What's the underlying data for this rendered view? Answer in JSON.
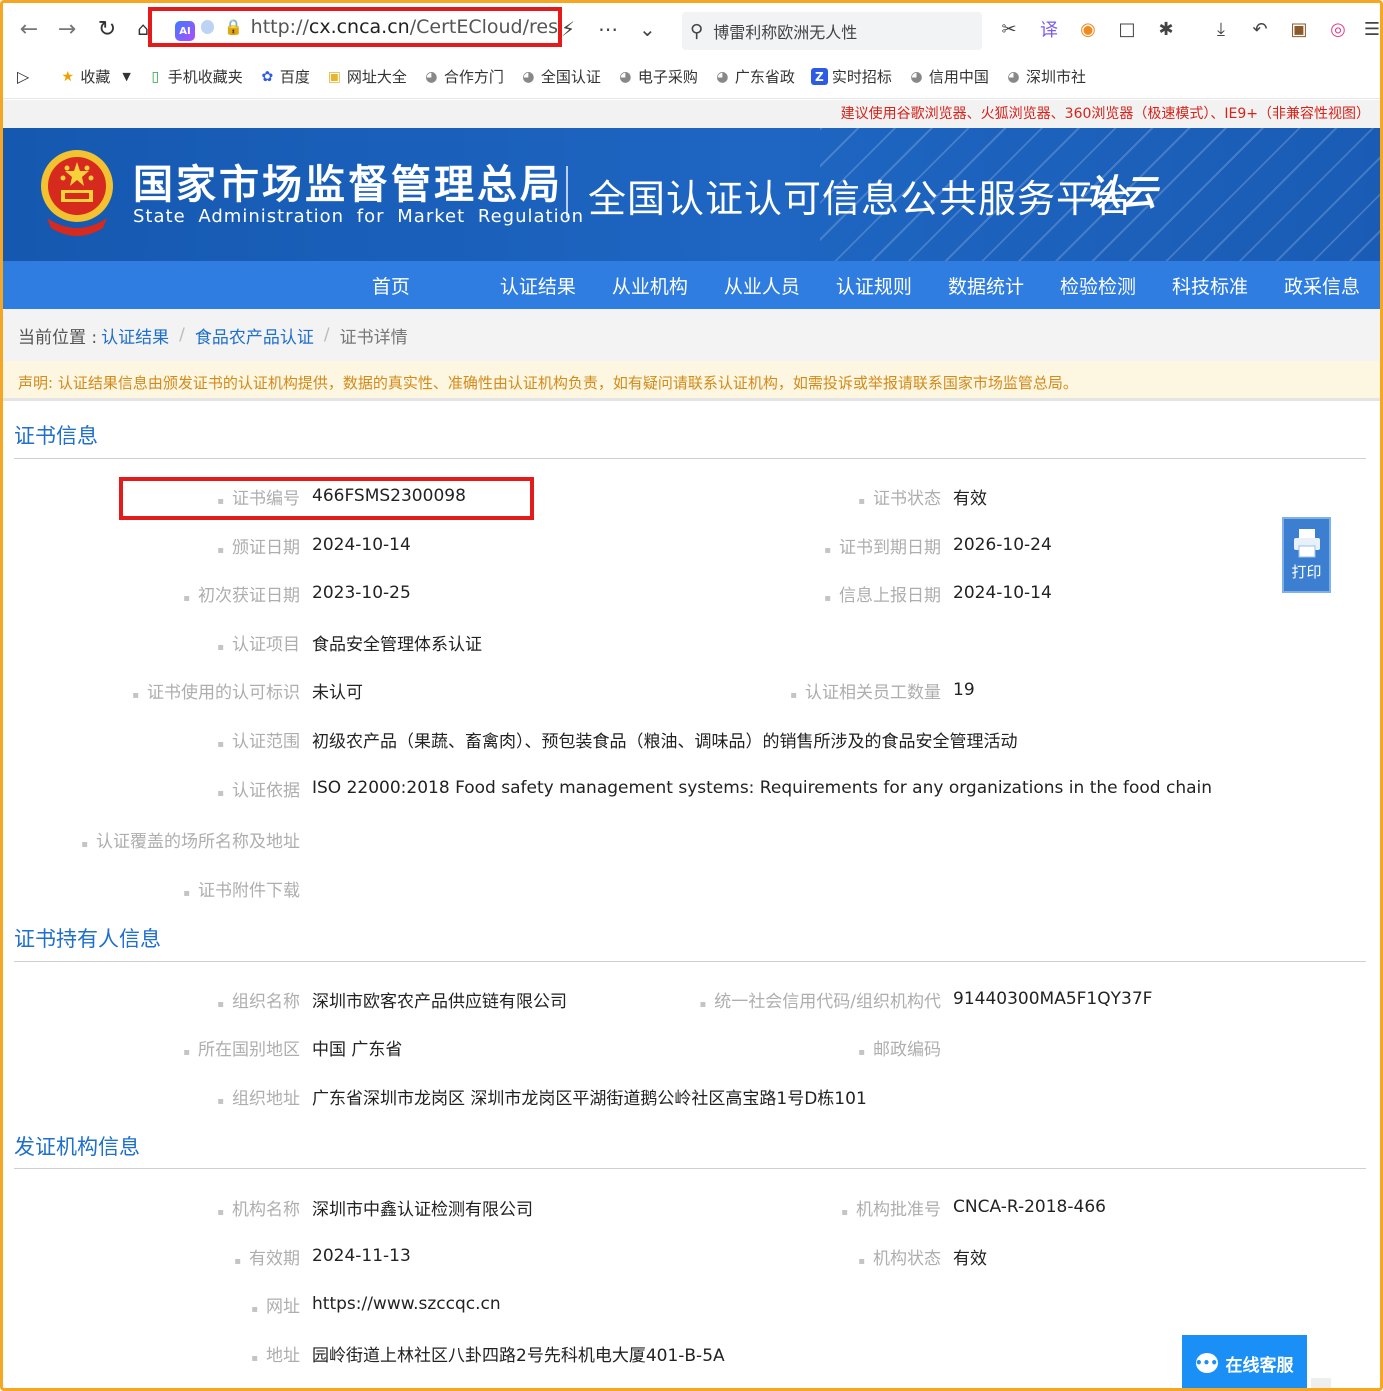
{
  "browser": {
    "url_prefix": "http://",
    "url_domain": "cx.cnca.cn",
    "url_path": "/CertECloud/res",
    "search_text": "博雷利称欧洲无人性",
    "ai_badge": "AI"
  },
  "bookmarks": [
    "收藏",
    "手机收藏夹",
    "百度",
    "网址大全",
    "合作方门",
    "全国认证",
    "电子采购",
    "广东省政",
    "实时招标",
    "信用中国",
    "深圳市社"
  ],
  "advisory": "建议使用谷歌浏览器、火狐浏览器、360浏览器（极速模式）、IE9+（非兼容性视图）",
  "banner": {
    "agency_cn": "国家市场监督管理总局",
    "agency_en": "State Administration  for  Market Regulation",
    "platform": "全国认证认可信息公共服务平台",
    "platform_logo": "认云"
  },
  "nav": [
    "首页",
    "认证结果",
    "从业机构",
    "从业人员",
    "认证规则",
    "数据统计",
    "检验检测",
    "科技标准",
    "政采信息"
  ],
  "breadcrumb": {
    "prefix": "当前位置 :",
    "items": [
      "认证结果",
      "食品农产品认证",
      "证书详情"
    ]
  },
  "disclaimer": "声明: 认证结果信息由颁发证书的认证机构提供，数据的真实性、准确性由认证机构负责，如有疑问请联系认证机构，如需投诉或举报请联系国家市场监管总局。",
  "cert_info": {
    "title": "证书信息",
    "cert_no_label": "证书编号",
    "cert_no": "466FSMS2300098",
    "status_label": "证书状态",
    "status": "有效",
    "issue_date_label": "颁证日期",
    "issue_date": "2024-10-14",
    "expiry_label": "证书到期日期",
    "expiry": "2026-10-24",
    "first_date_label": "初次获证日期",
    "first_date": "2023-10-25",
    "report_date_label": "信息上报日期",
    "report_date": "2024-10-14",
    "project_label": "认证项目",
    "project": "食品安全管理体系认证",
    "accred_label": "证书使用的认可标识",
    "accred": "未认可",
    "staff_label": "认证相关员工数量",
    "staff": "19",
    "scope_label": "认证范围",
    "scope": "初级农产品（果蔬、畜禽肉）、预包装食品（粮油、调味品）的销售所涉及的食品安全管理活动",
    "basis_label": "认证依据",
    "basis": "ISO 22000:2018 Food safety management systems: Requirements for any organizations in the food chain",
    "sites_label": "认证覆盖的场所名称及地址",
    "attach_label": "证书附件下载"
  },
  "print_label": "打印",
  "holder_info": {
    "title": "证书持有人信息",
    "org_label": "组织名称",
    "org": "深圳市欧客农产品供应链有限公司",
    "credit_label": "统一社会信用代码/组织机构代",
    "credit": "91440300MA5F1QY37F",
    "region_label": "所在国别地区",
    "region": "中国 广东省",
    "postcode_label": "邮政编码",
    "addr_label": "组织地址",
    "addr": "广东省深圳市龙岗区 深圳市龙岗区平湖街道鹅公岭社区高宝路1号D栋101"
  },
  "issuer_info": {
    "title": "发证机构信息",
    "name_label": "机构名称",
    "name": "深圳市中鑫认证检测有限公司",
    "approval_label": "机构批准号",
    "approval": "CNCA-R-2018-466",
    "validity_label": "有效期",
    "validity": "2024-11-13",
    "inst_status_label": "机构状态",
    "inst_status": "有效",
    "web_label": "网址",
    "web": "https://www.szccqc.cn",
    "address_label": "地址",
    "address": "园岭街道上林社区八卦四路2号先科机电大厦401-B-5A"
  },
  "chat_label": "在线客服",
  "colors": {
    "primary": "#1f6fcc",
    "nav": "#2f7de1",
    "banner": "#1558b0",
    "highlight": "#e31b1b",
    "disclaimer": "#d48a1a"
  }
}
